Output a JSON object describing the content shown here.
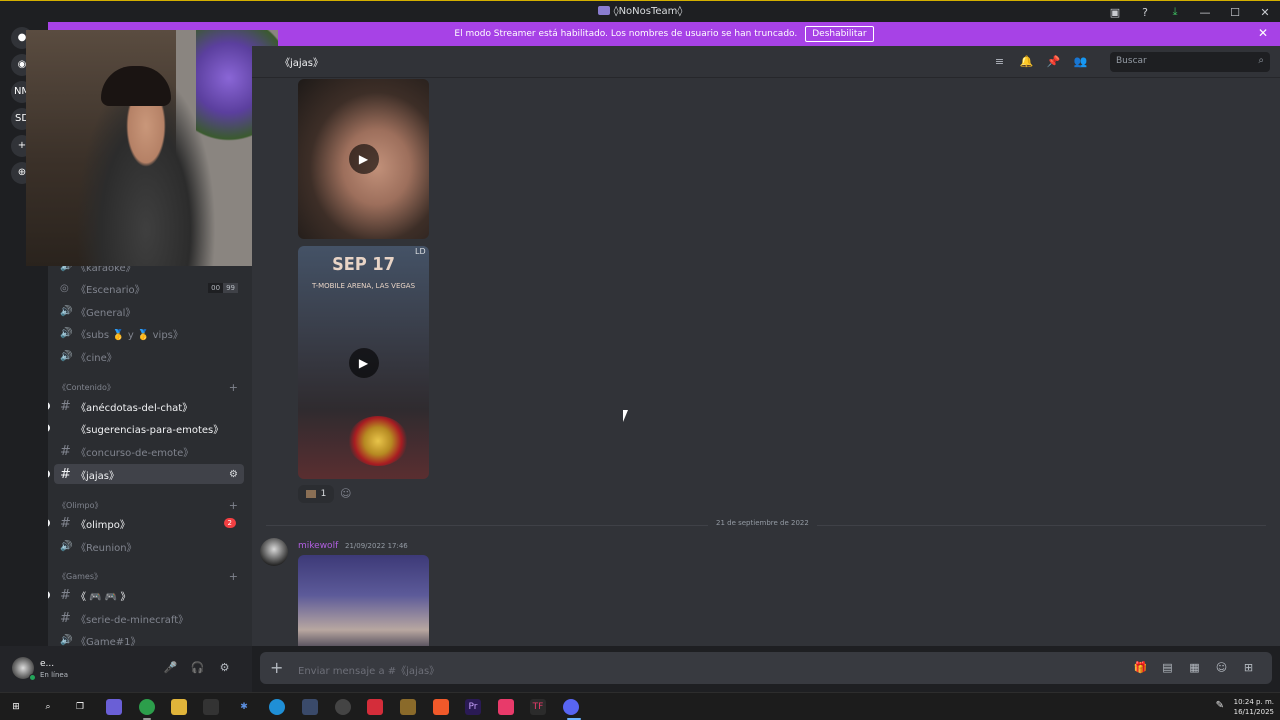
{
  "window": {
    "title": "◊NoNosTeam◊"
  },
  "banner": {
    "text": "El modo Streamer está habilitado. Los nombres de usuario se han truncado.",
    "button": "Deshabilitar"
  },
  "rail": {
    "servers": [
      "●",
      "◉",
      "NM",
      "SD",
      "+",
      "⊕"
    ]
  },
  "sidebar": {
    "voice_channels": [
      {
        "label": "《karaoke》",
        "icon": "speaker-icon"
      },
      {
        "label": "《Escenario》",
        "icon": "stage-icon",
        "counts": [
          "00",
          "99"
        ]
      },
      {
        "label": "《General》",
        "icon": "speaker-icon"
      },
      {
        "label": "《subs 🥇 y 🥇 vips》",
        "icon": "speaker-icon"
      },
      {
        "label": "《cine》",
        "icon": "speaker-icon"
      }
    ],
    "categories": {
      "contenido": "《Contenido》",
      "olimpo": "《Olimpo》",
      "games": "《Games》"
    },
    "text_channels": [
      {
        "label": "《anécdotas-del-chat》",
        "unread": true
      },
      {
        "label": "《sugerencias-para-emotes》",
        "unread": true
      },
      {
        "label": "《concurso-de-emote》",
        "unread": false
      },
      {
        "label": "《jajas》",
        "active": true
      },
      {
        "label": "《olimpo》",
        "badge": "2"
      },
      {
        "label": "《Reunion》",
        "voice": true
      },
      {
        "label": "《 🎮 🎮 》",
        "unread": true
      },
      {
        "label": "《serie-de-minecraft》",
        "unread": false
      },
      {
        "label": "《Game#1》",
        "voice": true
      }
    ]
  },
  "channel": {
    "name": "《jajas》",
    "search_placeholder": "Buscar"
  },
  "messages": {
    "media2": {
      "title": "SEP 17",
      "venue": "T-MOBILE ARENA, LAS VEGAS",
      "tag": "LD"
    },
    "reaction_count": "1",
    "date_divider": "21 de septiembre de 2022",
    "author": "mikewolf",
    "timestamp": "21/09/2022 17:46"
  },
  "composer": {
    "placeholder": "Enviar mensaje a #《jajas》"
  },
  "user": {
    "name": "e...",
    "status": "En línea"
  },
  "taskbar": {
    "time": "10:24 p. m.",
    "date": "16/11/2025"
  },
  "colors": {
    "banner": "#a742e6",
    "author": "#b15fe0",
    "online": "#23a55a",
    "badge": "#f23f42"
  }
}
